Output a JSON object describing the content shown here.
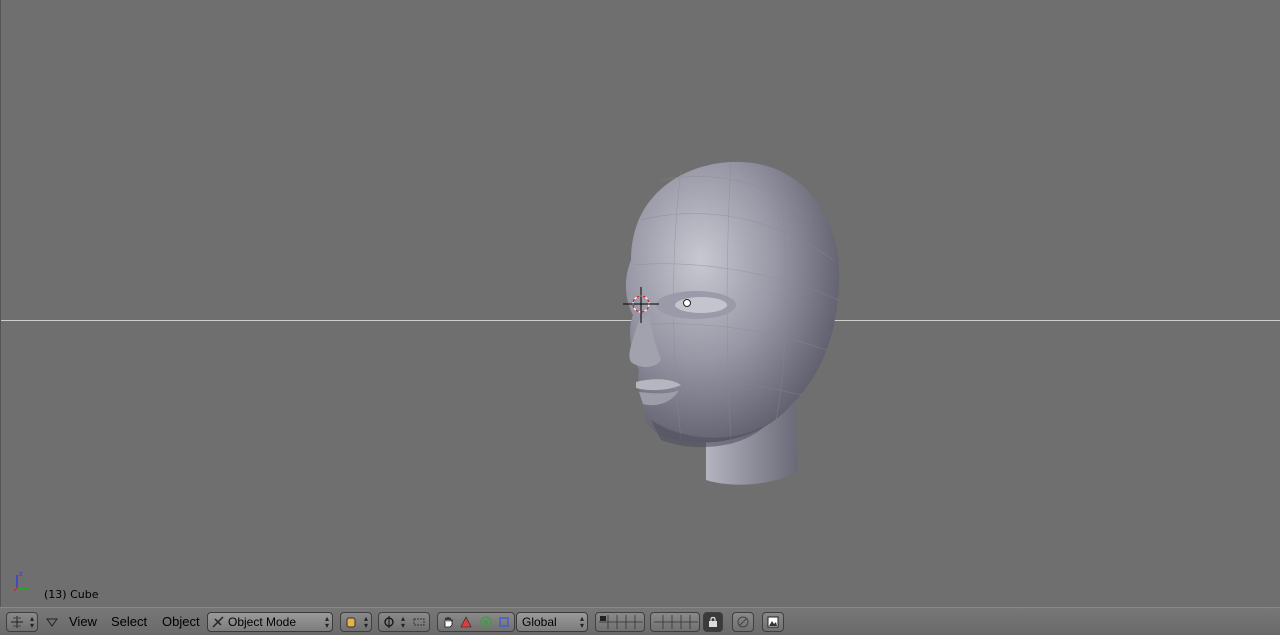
{
  "viewport": {
    "object_label": "(13) Cube",
    "background": "#6f6f6f"
  },
  "header": {
    "menus": [
      "View",
      "Select",
      "Object"
    ],
    "mode_select": "Object Mode",
    "orientation_select": "Global",
    "icons": [
      "editor-type-icon",
      "collapse-arrow-icon",
      "viewport-shading-icon",
      "pivot-point-icon",
      "snap-icon",
      "manipulator-hand-icon",
      "translate-icon",
      "rotate-icon",
      "scale-icon",
      "layers-icon",
      "lock-icon",
      "render-icon"
    ]
  }
}
